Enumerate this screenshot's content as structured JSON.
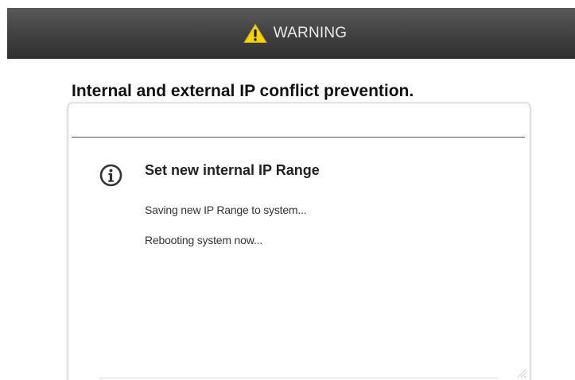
{
  "warning_bar": {
    "icon": "warning-triangle-icon",
    "label": "WARNING",
    "icon_color": "#f5d300"
  },
  "headline": "Internal and external IP conflict prevention.",
  "dialog": {
    "icon": "info-circle-icon",
    "title": "Set new internal IP Range",
    "lines": [
      "Saving new IP Range to system...",
      "Rebooting system now..."
    ]
  }
}
